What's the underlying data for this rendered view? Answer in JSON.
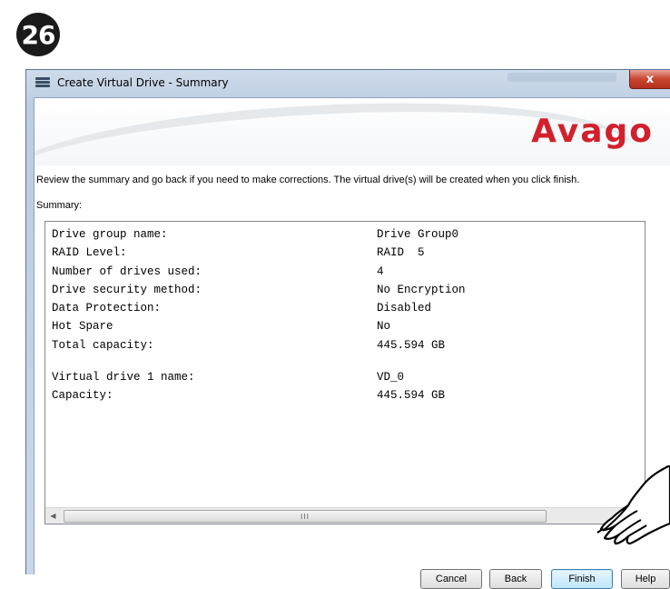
{
  "step": {
    "number": "26"
  },
  "window": {
    "title": "Create Virtual Drive - Summary",
    "close_label": "x",
    "title_icon": "server-stack-icon"
  },
  "banner": {
    "logo_text": "Avago",
    "logo_color": "#d2202d"
  },
  "instructions": "Review the summary and go back if you need to make corrections. The virtual drive(s) will be created when you click finish.",
  "summary": {
    "label": "Summary:",
    "rows": [
      {
        "key": "Drive group name:",
        "value": "Drive Group0"
      },
      {
        "key": "RAID Level:",
        "value": "RAID  5"
      },
      {
        "key": "Number of drives used:",
        "value": "4"
      },
      {
        "key": "Drive security method:",
        "value": "No Encryption"
      },
      {
        "key": "Data Protection:",
        "value": "Disabled"
      },
      {
        "key": "Hot Spare",
        "value": "No"
      },
      {
        "key": "Total capacity:",
        "value": "445.594 GB"
      },
      {
        "key": "Virtual drive 1 name:",
        "value": "VD_0"
      },
      {
        "key": "Capacity:",
        "value": "445.594 GB"
      }
    ]
  },
  "scrollbar": {
    "left_arrow": "◀",
    "thumb_grip": "III"
  },
  "buttons": {
    "cancel": "Cancel",
    "back": "Back",
    "finish": "Finish",
    "help": "Help"
  },
  "pointer": {
    "icon": "pointing-hand-icon"
  }
}
